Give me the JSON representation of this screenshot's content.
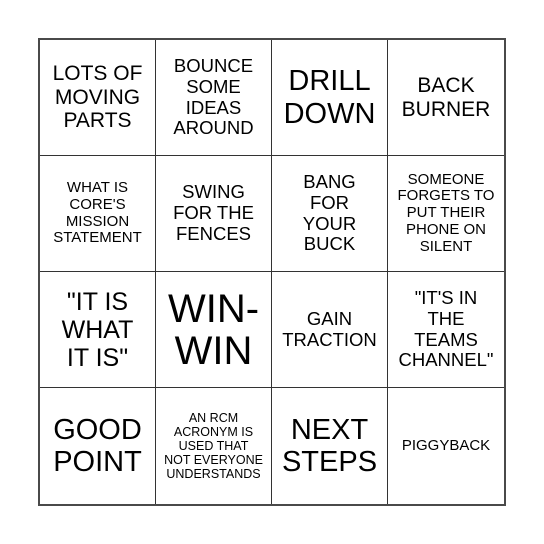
{
  "board": {
    "cells": [
      {
        "text": "LOTS OF\nMOVING\nPARTS",
        "size": "s-lg"
      },
      {
        "text": "BOUNCE\nSOME\nIDEAS\nAROUND",
        "size": "s-md"
      },
      {
        "text": "DRILL\nDOWN",
        "size": "s-xxl"
      },
      {
        "text": "BACK\nBURNER",
        "size": "s-lg"
      },
      {
        "text": "WHAT IS\nCORE'S\nMISSION\nSTATEMENT",
        "size": "s-sm"
      },
      {
        "text": "SWING\nFOR THE\nFENCES",
        "size": "s-md"
      },
      {
        "text": "BANG\nFOR\nYOUR\nBUCK",
        "size": "s-md"
      },
      {
        "text": "SOMEONE\nFORGETS TO\nPUT THEIR\nPHONE ON\nSILENT",
        "size": "s-sm"
      },
      {
        "text": "\"IT IS\nWHAT\nIT IS\"",
        "size": "s-xl"
      },
      {
        "text": "WIN-\nWIN",
        "size": "s-huge"
      },
      {
        "text": "GAIN\nTRACTION",
        "size": "s-md"
      },
      {
        "text": "\"IT'S IN\nTHE\nTEAMS\nCHANNEL\"",
        "size": "s-md"
      },
      {
        "text": "GOOD\nPOINT",
        "size": "s-xxl"
      },
      {
        "text": "AN RCM\nACRONYM IS\nUSED THAT\nNOT EVERYONE\nUNDERSTANDS",
        "size": "s-xs"
      },
      {
        "text": "NEXT\nSTEPS",
        "size": "s-xxl"
      },
      {
        "text": "PIGGYBACK",
        "size": "s-sm"
      }
    ]
  }
}
